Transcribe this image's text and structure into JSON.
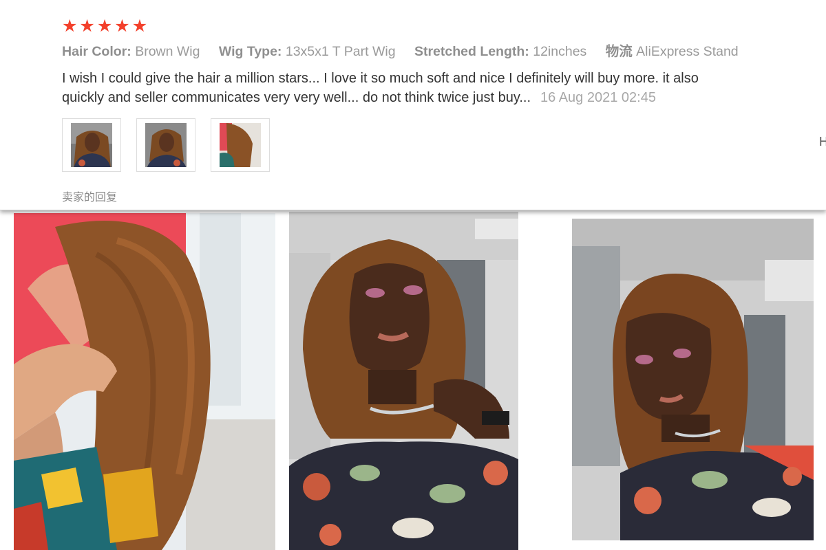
{
  "review": {
    "rating": 5,
    "stars": [
      "★",
      "★",
      "★",
      "★",
      "★"
    ],
    "attributes": [
      {
        "key": "Hair Color:",
        "value": "Brown Wig"
      },
      {
        "key": "Wig Type:",
        "value": "13x5x1 T Part Wig"
      },
      {
        "key": "Stretched Length:",
        "value": "12inches"
      },
      {
        "key": "物流",
        "value": "AliExpress Stand"
      }
    ],
    "text_line1": "I wish I could give the hair a million stars... I love it so much soft and nice I definitely will buy more. it also",
    "text_line2": "quickly and seller communicates very very well... do not think twice just buy...",
    "date": "16 Aug 2021 02:45",
    "seller_reply": "卖家的回复",
    "edge_letter": "H",
    "thumbnails": [
      "review-photo-1",
      "review-photo-2",
      "review-photo-3"
    ]
  },
  "colors": {
    "star": "#f3402b",
    "text": "#333333",
    "muted": "#9a9a9a",
    "hair": "#8a5226"
  }
}
